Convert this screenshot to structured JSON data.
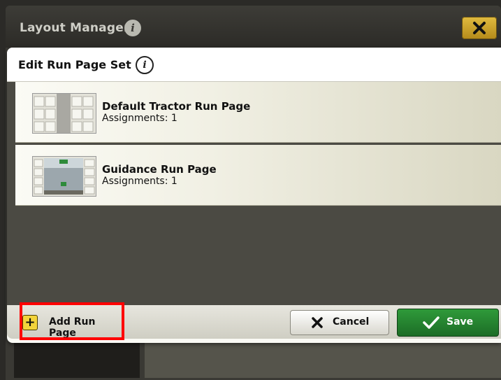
{
  "window": {
    "title": "Layout Manager",
    "info_glyph": "i",
    "close_glyph": "✕"
  },
  "dialog": {
    "title": "Edit Run Page Set",
    "info_glyph": "i"
  },
  "run_pages": [
    {
      "title": "Default Tractor Run Page",
      "assignments": "Assignments: 1",
      "thumbnail": "default-tractor-thumbnail"
    },
    {
      "title": "Guidance Run Page",
      "assignments": "Assignments: 1",
      "thumbnail": "guidance-thumbnail"
    }
  ],
  "footer": {
    "add_label": "Add Run Page",
    "add_glyph": "+",
    "cancel_label": "Cancel",
    "save_label": "Save"
  },
  "colors": {
    "accent_save": "#2f9a3a",
    "add_icon": "#f2d33b",
    "highlight": "#ff0000"
  }
}
